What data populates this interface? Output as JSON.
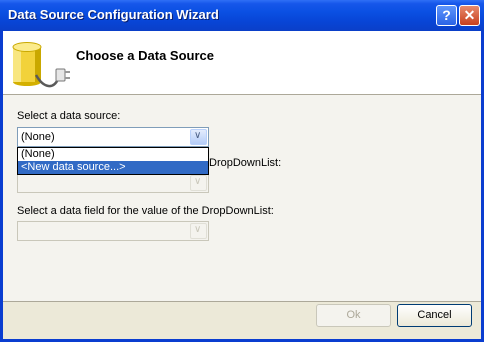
{
  "window": {
    "title": "Data Source Configuration Wizard",
    "help_label": "?",
    "close_label": "✕"
  },
  "header": {
    "title": "Choose a Data Source",
    "icon": "database-plug-icon"
  },
  "form": {
    "source_label": "Select a data source:",
    "source_value": "(None)",
    "source_options": [
      "(None)",
      "<New data source...>"
    ],
    "display_label_partial": "DropDownList:",
    "display_value": "",
    "value_label": "Select a data field for the value of the DropDownList:",
    "value_value": ""
  },
  "buttons": {
    "ok": "Ok",
    "cancel": "Cancel"
  }
}
